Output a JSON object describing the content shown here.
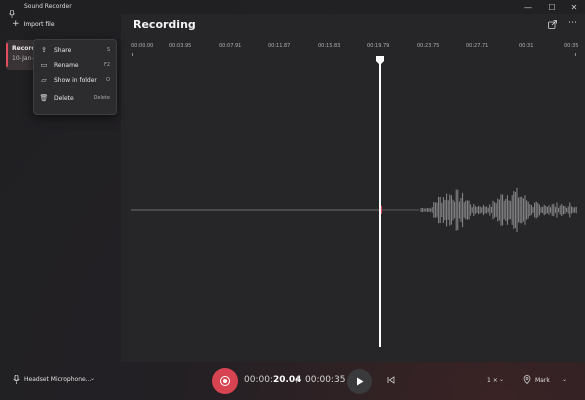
{
  "titlebar": {
    "app_title": "Sound Recorder",
    "minimize": "—",
    "maximize": "☐",
    "close": "✕"
  },
  "sidebar": {
    "import_label": "Import file",
    "recording_item": {
      "name": "Recordi",
      "date": "10-Jan-"
    }
  },
  "context_menu": {
    "items": [
      {
        "label": "Share",
        "shortcut": "S",
        "icon": "share-icon"
      },
      {
        "label": "Rename",
        "shortcut": "F2",
        "icon": "rename-icon"
      },
      {
        "label": "Show in folder",
        "shortcut": "O",
        "icon": "folder-icon"
      },
      {
        "label": "Delete",
        "shortcut": "Delete",
        "icon": "trash-icon"
      }
    ]
  },
  "main": {
    "title": "Recording",
    "ruler_labels": [
      "00:00.00",
      "00:03.95",
      "00:07.91",
      "00:11.87",
      "00:15.83",
      "00:19.79",
      "00:23.75",
      "00:27.71",
      "00:31",
      "00:35"
    ]
  },
  "player": {
    "mic_label": "Headset Microphone...",
    "time_prefix": "00:00:",
    "time_seconds": "20.04",
    "time_sep": "/",
    "total": "00:00:35",
    "speed": "1 ×",
    "mark_label": "Mark"
  },
  "colors": {
    "accent": "#d84352",
    "playhead": "#ffffff"
  }
}
